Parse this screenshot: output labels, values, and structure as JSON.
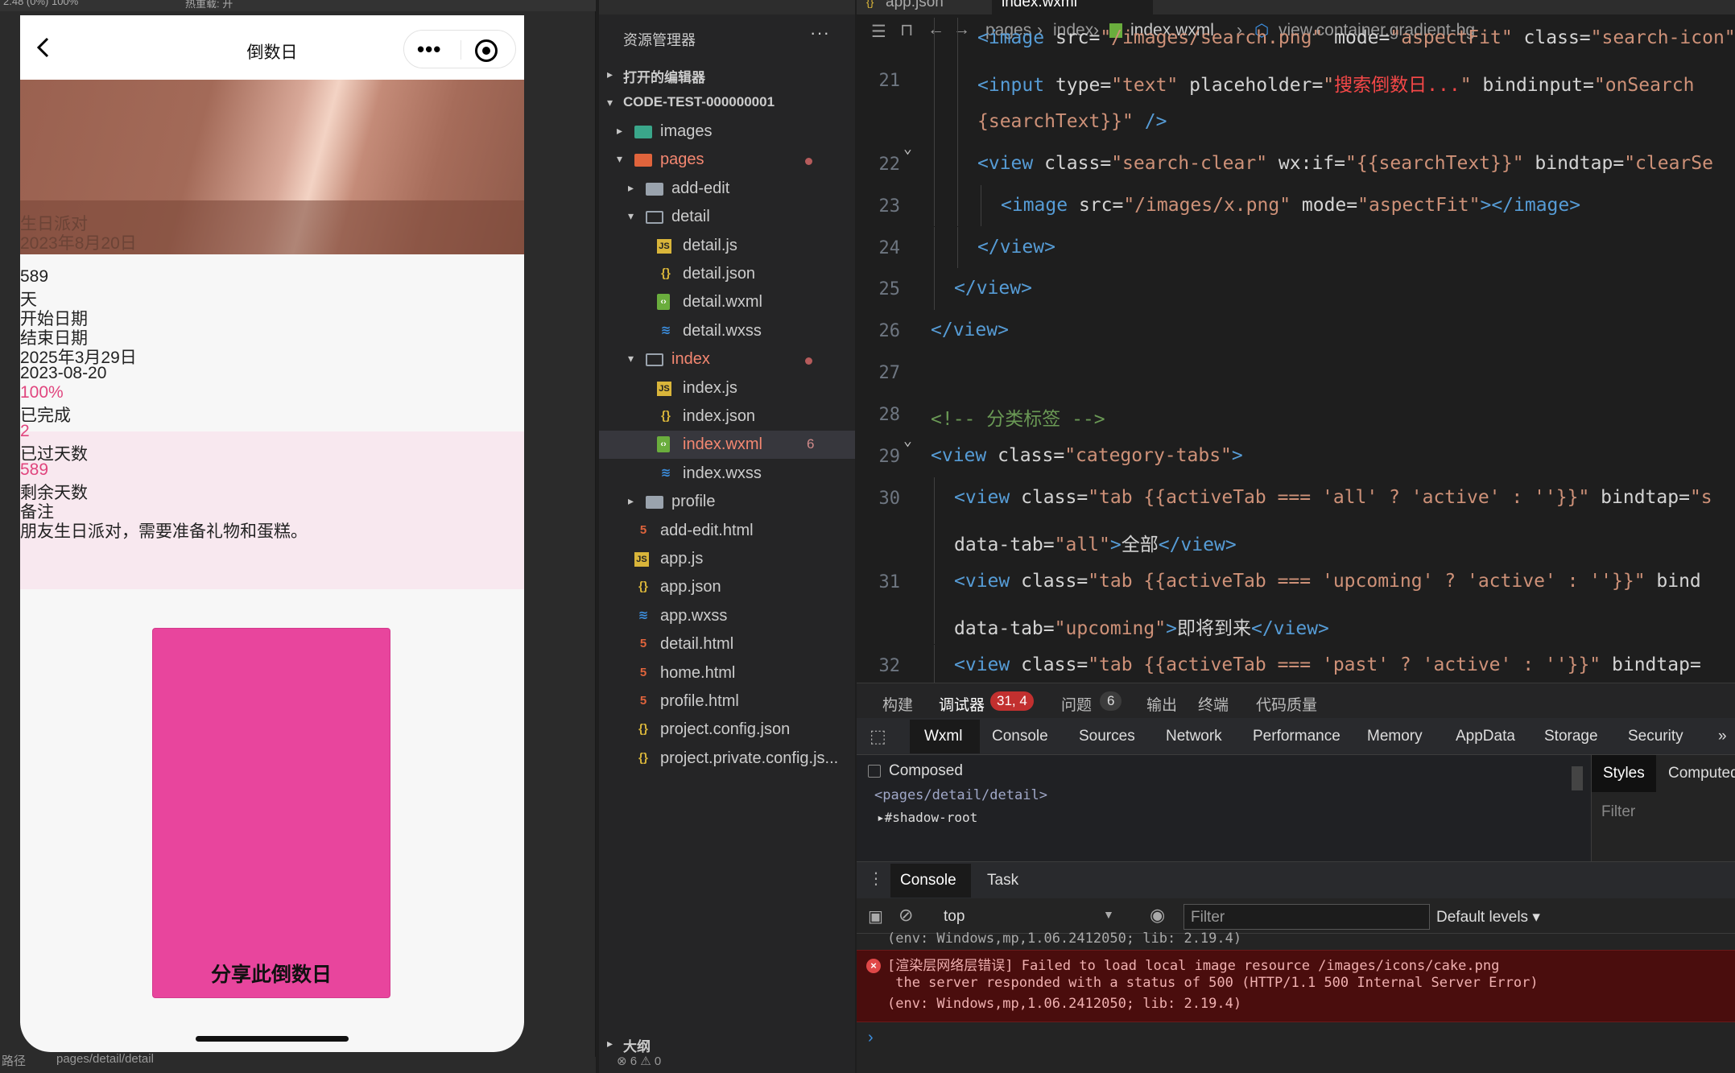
{
  "simulator": {
    "top_fragment_left": "2.48 (0%)  100%",
    "top_fragment_right": "热重载: 开",
    "nav_title": "倒数日",
    "hero": {
      "event_name": "生日派对",
      "event_date": "2023年8月20日"
    },
    "lines": [
      {
        "text": "589",
        "style": "normal"
      },
      {
        "text": "天",
        "style": "normal"
      },
      {
        "text": "开始日期",
        "style": "normal"
      },
      {
        "text": "结束日期",
        "style": "normal"
      },
      {
        "text": "2025年3月29日",
        "style": "normal"
      },
      {
        "text": "2023-08-20",
        "style": "normal"
      },
      {
        "text": "100%",
        "style": "pink"
      },
      {
        "text": "已完成",
        "style": "normal"
      },
      {
        "text": "2",
        "style": "pink"
      },
      {
        "text": "已过天数",
        "style": "normal"
      },
      {
        "text": "589",
        "style": "pink"
      },
      {
        "text": "剩余天数",
        "style": "normal"
      },
      {
        "text": "备注",
        "style": "normal"
      },
      {
        "text": "朋友生日派对，需要准备礼物和蛋糕。",
        "style": "normal"
      }
    ],
    "share_button": "分享此倒数日",
    "status_left": "路径",
    "status_path": "pages/detail/detail"
  },
  "explorer": {
    "title": "资源管理器",
    "sections": {
      "open_editors": "打开的编辑器",
      "project": "CODE-TEST-000000001",
      "outline": "大纲"
    },
    "tree": [
      {
        "name": "images",
        "type": "folder-img",
        "level": 1,
        "arrow": "▸"
      },
      {
        "name": "pages",
        "type": "folder-pages",
        "level": 1,
        "arrow": "▾",
        "highlight": true,
        "dot": true
      },
      {
        "name": "add-edit",
        "type": "folder",
        "level": 2,
        "arrow": "▸"
      },
      {
        "name": "detail",
        "type": "folder-open",
        "level": 2,
        "arrow": "▾"
      },
      {
        "name": "detail.js",
        "type": "js",
        "level": 3
      },
      {
        "name": "detail.json",
        "type": "json",
        "level": 3
      },
      {
        "name": "detail.wxml",
        "type": "wxml",
        "level": 3
      },
      {
        "name": "detail.wxss",
        "type": "wxss",
        "level": 3
      },
      {
        "name": "index",
        "type": "folder-open",
        "level": 2,
        "arrow": "▾",
        "highlight": true,
        "dot": true
      },
      {
        "name": "index.js",
        "type": "js",
        "level": 3
      },
      {
        "name": "index.json",
        "type": "json",
        "level": 3
      },
      {
        "name": "index.wxml",
        "type": "wxml",
        "level": 3,
        "highlight": true,
        "selected": true,
        "count": "6"
      },
      {
        "name": "index.wxss",
        "type": "wxss",
        "level": 3
      },
      {
        "name": "profile",
        "type": "folder",
        "level": 2,
        "arrow": "▸"
      },
      {
        "name": "add-edit.html",
        "type": "html",
        "level": 1
      },
      {
        "name": "app.js",
        "type": "js",
        "level": 1
      },
      {
        "name": "app.json",
        "type": "json",
        "level": 1
      },
      {
        "name": "app.wxss",
        "type": "wxss",
        "level": 1
      },
      {
        "name": "detail.html",
        "type": "html",
        "level": 1
      },
      {
        "name": "home.html",
        "type": "html",
        "level": 1
      },
      {
        "name": "profile.html",
        "type": "html",
        "level": 1
      },
      {
        "name": "project.config.json",
        "type": "json",
        "level": 1
      },
      {
        "name": "project.private.config.js...",
        "type": "json",
        "level": 1
      }
    ],
    "status": "⊗ 6 ⚠ 0"
  },
  "editor": {
    "tabs": [
      "app.json",
      "index.wxml"
    ],
    "breadcrumb": [
      "pages",
      "index",
      "index.wxml",
      "view.container.gradient-bg"
    ],
    "lines": [
      {
        "num": "",
        "indent": 2,
        "tokens": [
          [
            "t-tag",
            "<image "
          ],
          [
            "t-attr",
            "src="
          ],
          [
            "t-str",
            "\"/images/search.png\""
          ],
          [
            "t-attr",
            " mode="
          ],
          [
            "t-str",
            "\"aspectFit\""
          ],
          [
            "t-attr",
            " class="
          ],
          [
            "t-str",
            "\"search-icon\""
          ]
        ]
      },
      {
        "num": "21",
        "indent": 2,
        "tokens": [
          [
            "t-tag",
            "<input "
          ],
          [
            "t-attr",
            "type="
          ],
          [
            "t-str",
            "\"text\""
          ],
          [
            "t-attr",
            " placeholder="
          ],
          [
            "t-str",
            "\""
          ],
          [
            "t-red",
            "搜索倒数日..."
          ],
          [
            "t-str",
            "\""
          ],
          [
            "t-attr",
            " bindinput="
          ],
          [
            "t-str",
            "\"onSearch"
          ]
        ]
      },
      {
        "num": "",
        "indent": 2,
        "tokens": [
          [
            "t-str",
            "{searchText}}\""
          ],
          [
            "t-tag",
            " />"
          ]
        ]
      },
      {
        "num": "22",
        "indent": 2,
        "fold": true,
        "tokens": [
          [
            "t-tag",
            "<view "
          ],
          [
            "t-attr",
            "class="
          ],
          [
            "t-str",
            "\"search-clear\""
          ],
          [
            "t-attr",
            " wx:if="
          ],
          [
            "t-str",
            "\"{{searchText}}\""
          ],
          [
            "t-attr",
            " bindtap="
          ],
          [
            "t-str",
            "\"clearSe"
          ]
        ]
      },
      {
        "num": "23",
        "indent": 3,
        "tokens": [
          [
            "t-tag",
            "<image "
          ],
          [
            "t-attr",
            "src="
          ],
          [
            "t-str",
            "\"/images/x.png\""
          ],
          [
            "t-attr",
            " mode="
          ],
          [
            "t-str",
            "\"aspectFit\""
          ],
          [
            "t-tag",
            "></image>"
          ]
        ]
      },
      {
        "num": "24",
        "indent": 2,
        "tokens": [
          [
            "t-tag",
            "</view>"
          ]
        ]
      },
      {
        "num": "25",
        "indent": 1,
        "tokens": [
          [
            "t-tag",
            "</view>"
          ]
        ]
      },
      {
        "num": "26",
        "indent": 0,
        "tokens": [
          [
            "t-tag",
            "</view>"
          ]
        ]
      },
      {
        "num": "27",
        "indent": 0,
        "tokens": []
      },
      {
        "num": "28",
        "indent": 0,
        "tokens": [
          [
            "t-com",
            "<!-- 分类标签 -->"
          ]
        ]
      },
      {
        "num": "29",
        "indent": 0,
        "fold": true,
        "tokens": [
          [
            "t-tag",
            "<view "
          ],
          [
            "t-attr",
            "class="
          ],
          [
            "t-str",
            "\"category-tabs\""
          ],
          [
            "t-tag",
            ">"
          ]
        ]
      },
      {
        "num": "30",
        "indent": 1,
        "tokens": [
          [
            "t-tag",
            "<view "
          ],
          [
            "t-attr",
            "class="
          ],
          [
            "t-str",
            "\"tab {{activeTab === 'all' ? 'active' : ''}}\""
          ],
          [
            "t-attr",
            " bindtap="
          ],
          [
            "t-str",
            "\"s"
          ]
        ]
      },
      {
        "num": "",
        "indent": 1,
        "tokens": [
          [
            "t-attr",
            "data-tab="
          ],
          [
            "t-str",
            "\"all\""
          ],
          [
            "t-tag",
            ">"
          ],
          [
            "t-txt",
            "全部"
          ],
          [
            "t-tag",
            "</view>"
          ]
        ]
      },
      {
        "num": "31",
        "indent": 1,
        "tokens": [
          [
            "t-tag",
            "<view "
          ],
          [
            "t-attr",
            "class="
          ],
          [
            "t-str",
            "\"tab {{activeTab === 'upcoming' ? 'active' : ''}}\""
          ],
          [
            "t-attr",
            " bind"
          ]
        ]
      },
      {
        "num": "",
        "indent": 1,
        "tokens": [
          [
            "t-attr",
            "data-tab="
          ],
          [
            "t-str",
            "\"upcoming\""
          ],
          [
            "t-tag",
            ">"
          ],
          [
            "t-txt",
            "即将到来"
          ],
          [
            "t-tag",
            "</view>"
          ]
        ]
      },
      {
        "num": "32",
        "indent": 1,
        "tokens": [
          [
            "t-tag",
            "<view "
          ],
          [
            "t-attr",
            "class="
          ],
          [
            "t-str",
            "\"tab {{activeTab === 'past' ? 'active' : ''}}\""
          ],
          [
            "t-attr",
            " bindtap="
          ]
        ]
      }
    ]
  },
  "panel_tabs": {
    "build": "构建",
    "debugger": "调试器",
    "debugger_badge": "31, 4",
    "problems": "问题",
    "problems_badge": "6",
    "output": "输出",
    "terminal": "终端",
    "code_quality": "代码质量"
  },
  "devtools": {
    "tabs": [
      "Wxml",
      "Console",
      "Sources",
      "Network",
      "Performance",
      "Memory",
      "AppData",
      "Storage",
      "Security"
    ],
    "more": "»",
    "composed": "Composed",
    "dom_path": "<pages/detail/detail>",
    "shadow_root": "#shadow-root",
    "styles": "Styles",
    "computed": "Computed",
    "styles_filter": "Filter",
    "drawer_tabs": [
      "Console",
      "Task"
    ],
    "context": "top",
    "filter_placeholder": "Filter",
    "levels": "Default levels ▾",
    "cut_line": "(env: Windows,mp,1.06.2412050; lib: 2.19.4)",
    "error": {
      "line1": "[渲染层网络层错误] Failed to load local image resource /images/icons/cake.png",
      "line2": " the server responded with a status of 500 (HTTP/1.1 500 Internal Server Error)",
      "line3": "(env: Windows,mp,1.06.2412050; lib: 2.19.4)"
    },
    "prompt": "›"
  },
  "colors": {
    "pink": "#e0457e",
    "share_button": "#e8459d",
    "stats_band": "#f8e8ef",
    "error_bg": "#4a0d0d",
    "accent_red_badge": "#c2302f"
  }
}
